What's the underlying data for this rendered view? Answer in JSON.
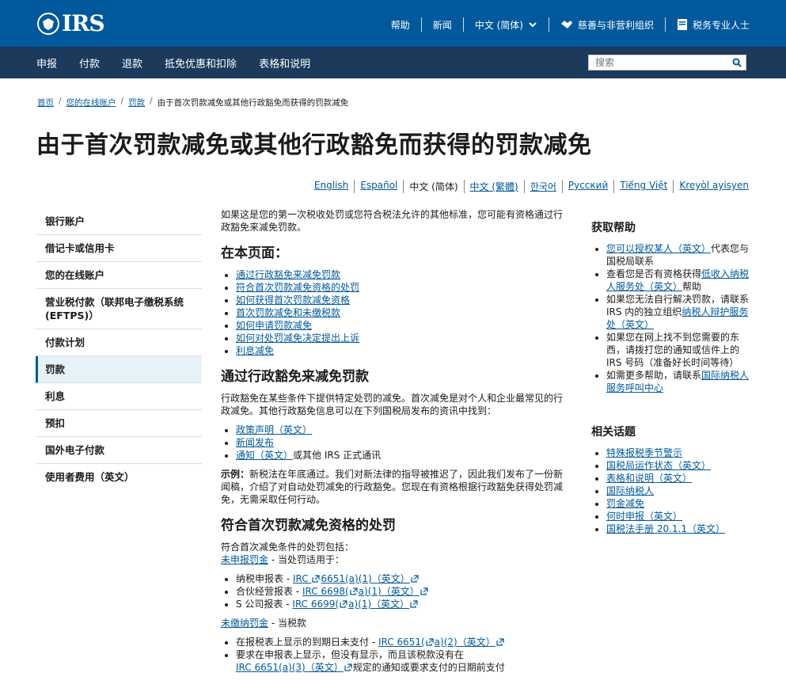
{
  "header": {
    "logo_text": "IRS",
    "help": "帮助",
    "news": "新闻",
    "language": "中文 (简体)",
    "charities": "慈善与非营利组织",
    "tax_pros": "税务专业人士"
  },
  "nav": {
    "items": [
      "申报",
      "付款",
      "退款",
      "抵免优惠和扣除",
      "表格和说明"
    ],
    "search_placeholder": "搜索"
  },
  "breadcrumb": [
    "首页",
    "您的在线账户",
    "罚款",
    "由于首次罚款减免或其他行政豁免而获得的罚款减免"
  ],
  "page_title": "由于首次罚款减免或其他行政豁免而获得的罚款减免",
  "languages": [
    "English",
    "Español",
    "中文 (简体)",
    "中文 (繁體)",
    "한국어",
    "Русский",
    "Tiếng Việt",
    "Kreyòl ayisyen"
  ],
  "sidenav": [
    "银行账户",
    "借记卡或信用卡",
    "您的在线账户",
    "营业税付款（联邦电子缴税系统 (EFTPS)）",
    "付款计划",
    "罚款",
    "利息",
    "预扣",
    "国外电子付款",
    "使用者费用（英文）"
  ],
  "main": {
    "intro": "如果这是您的第一次税收处罚或您符合税法允许的其他标准，您可能有资格通过行政豁免来减免罚款。",
    "on_page_title": "在本页面：",
    "on_page_links": [
      "通过行政豁免来减免罚款",
      "符合首次罚款减免资格的处罚",
      "如何获得首次罚款减免资格",
      "首次罚款减免和未缴税款",
      "如何申请罚款减免",
      "如何对处罚减免决定提出上诉",
      "利息减免"
    ],
    "s1_title": "通过行政豁免来减免罚款",
    "s1_text": "行政豁免在某些条件下提供特定处罚的减免。首次减免是对个人和企业最常见的行政减免。其他行政豁免信息可以在下列国税局发布的资讯中找到：",
    "s1_list": [
      {
        "link": "政策声明（英文）",
        "rest": ""
      },
      {
        "link": "新闻发布",
        "rest": ""
      },
      {
        "link": "通知（英文）",
        "rest": "或其他 IRS 正式通讯"
      }
    ],
    "example_label": "示例：",
    "example_text": "新税法在年底通过。我们对新法律的指导被推迟了，因此我们发布了一份新闻稿，介绍了对自动处罚减免的行政豁免。您现在有资格根据行政豁免获得处罚减免，无需采取任何行动。",
    "s2_title": "符合首次罚款减免资格的处罚",
    "s2_intro": "符合首次减免条件的处罚包括：",
    "fail_file_link": "未申报罚金",
    "fail_file_rest": " - 当处罚适用于：",
    "fail_file_list": [
      {
        "pre": "纳税申报表 - ",
        "l1": "IRC ",
        "l2": "6651(a)(1)（英文）"
      },
      {
        "pre": "合伙经营报表 - ",
        "l1": "IRC 6698(",
        "l2": "a)(1)（英文）"
      },
      {
        "pre": "S 公司报表 - ",
        "l1": "IRC 6699(",
        "l2": "a)(1)（英文）"
      }
    ],
    "fail_pay_link": "未缴纳罚金",
    "fail_pay_rest": " - 当税款",
    "fail_pay_list_1_pre": "在报税表上显示的到期日未支付 - ",
    "fail_pay_list_1_l1": "IRC 6651(",
    "fail_pay_list_1_l2": "a)(2)（英文）",
    "fail_pay_list_2_pre": "要求在申报表上显示，但没有显示，而且该税款没有在",
    "fail_pay_list_2_link": "IRC 6651(a)(3)（英文）",
    "fail_pay_list_2_rest": "规定的通知或要求支付的日期前支付"
  },
  "aside": {
    "help_title": "获取帮助",
    "help_items": [
      {
        "link": "您可以授权某人（英文）",
        "rest": "代表您与国税局联系",
        "pre": ""
      },
      {
        "pre": "查看您是否有资格获得",
        "link": "低收入纳税人服务处（英文）",
        "rest": "帮助"
      },
      {
        "pre": "如果您无法自行解决罚款，请联系IRS 内的独立组织",
        "link": "纳税人辩护服务处（英文）",
        "rest": ""
      },
      {
        "pre": "如果您在网上找不到您需要的东西，请拨打您的通知或信件上的 IRS 号码（准备好长时间等待）",
        "link": "",
        "rest": ""
      },
      {
        "pre": "如需更多帮助，请联系",
        "link": "国际纳税人服务呼叫中心",
        "rest": ""
      }
    ],
    "related_title": "相关话题",
    "related_items": [
      "特殊报税季节警示",
      "国税局运作状态（英文）",
      "表格和说明（英文）",
      "国际纳税人",
      "罚金减免",
      "何时申报（英文）",
      "国税法手册 20.1.1（英文）"
    ]
  },
  "colors": {
    "primary": "#00599c",
    "nav_dark": "#1b3a5c",
    "active_bg": "#e7f2f8"
  }
}
